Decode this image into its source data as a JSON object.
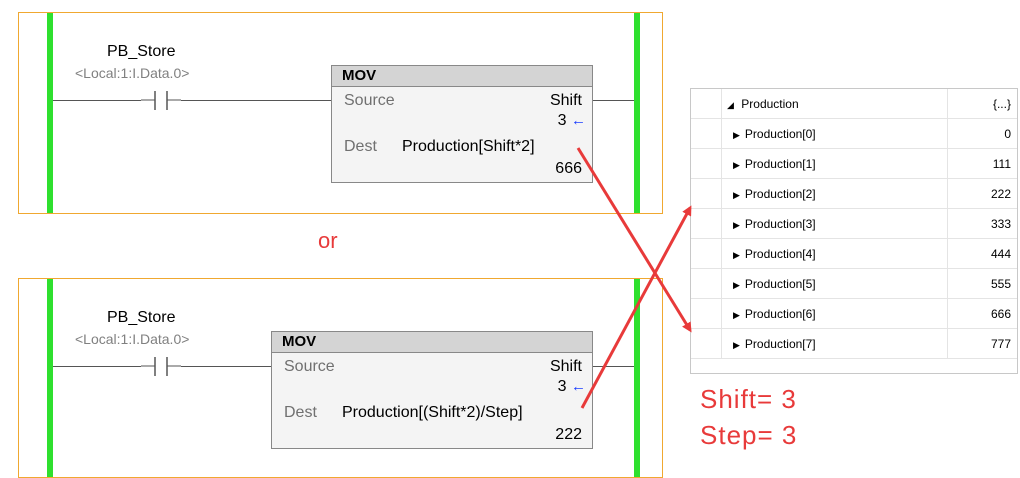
{
  "rung1": {
    "contact_tag": "PB_Store",
    "contact_alias": "<Local:1:I.Data.0>",
    "mov_title": "MOV",
    "source_label": "Source",
    "source_tag": "Shift",
    "source_value": "3",
    "dest_label": "Dest",
    "dest_tag": "Production[Shift*2]",
    "dest_value": "666"
  },
  "or_text": "or",
  "rung2": {
    "contact_tag": "PB_Store",
    "contact_alias": "<Local:1:I.Data.0>",
    "mov_title": "MOV",
    "source_label": "Source",
    "source_tag": "Shift",
    "source_value": "3",
    "dest_label": "Dest",
    "dest_tag": "Production[(Shift*2)/Step]",
    "dest_value": "222"
  },
  "watch": {
    "parent_name": "Production",
    "parent_value": "{...}",
    "rows": [
      {
        "name": "Production[0]",
        "value": "0"
      },
      {
        "name": "Production[1]",
        "value": "111"
      },
      {
        "name": "Production[2]",
        "value": "222"
      },
      {
        "name": "Production[3]",
        "value": "333"
      },
      {
        "name": "Production[4]",
        "value": "444"
      },
      {
        "name": "Production[5]",
        "value": "555"
      },
      {
        "name": "Production[6]",
        "value": "666"
      },
      {
        "name": "Production[7]",
        "value": "777"
      }
    ]
  },
  "notes": {
    "shift": "Shift= 3",
    "step": "Step= 3"
  },
  "colors": {
    "rail": "#2ee02e",
    "rung_border": "#f0a830",
    "annotation": "#e83a3a",
    "pointer": "#1a3cff"
  }
}
